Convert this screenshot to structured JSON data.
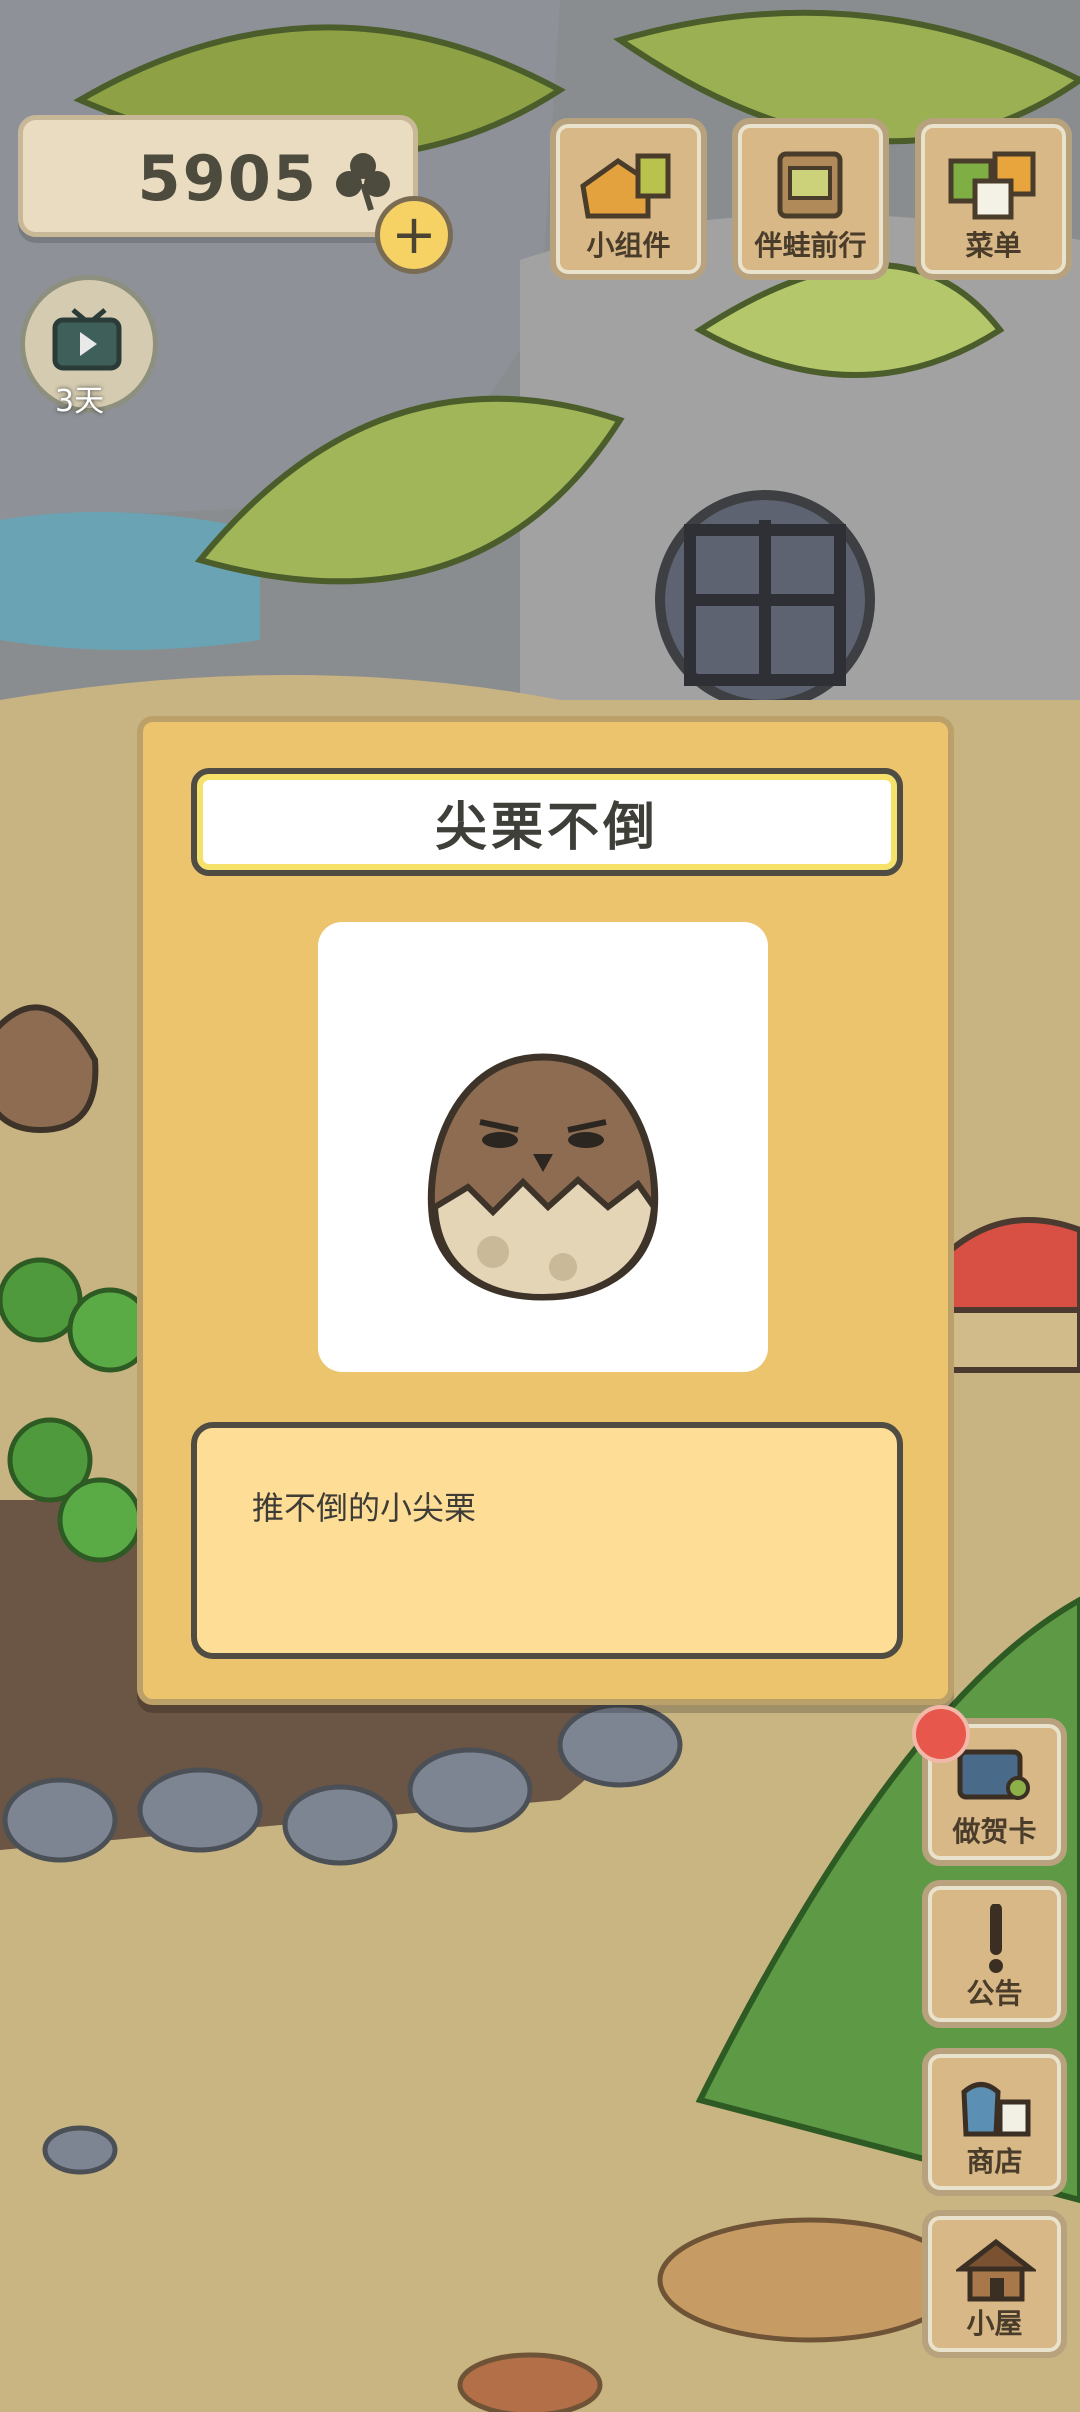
{
  "hud": {
    "currency_value": "5905",
    "tv_days": "3天"
  },
  "top_buttons": [
    {
      "label": "小组件"
    },
    {
      "label": "伴蛙前行"
    },
    {
      "label": "菜单"
    }
  ],
  "dialog": {
    "title": "尖栗不倒",
    "description": "推不倒的小尖栗"
  },
  "side_buttons": [
    {
      "label": "做贺卡"
    },
    {
      "label": "公告"
    },
    {
      "label": "商店"
    },
    {
      "label": "小屋"
    }
  ],
  "colors": {
    "dialog_bg": "#edc46e",
    "desc_bg": "#fedd96",
    "notification": "#e7574b"
  }
}
